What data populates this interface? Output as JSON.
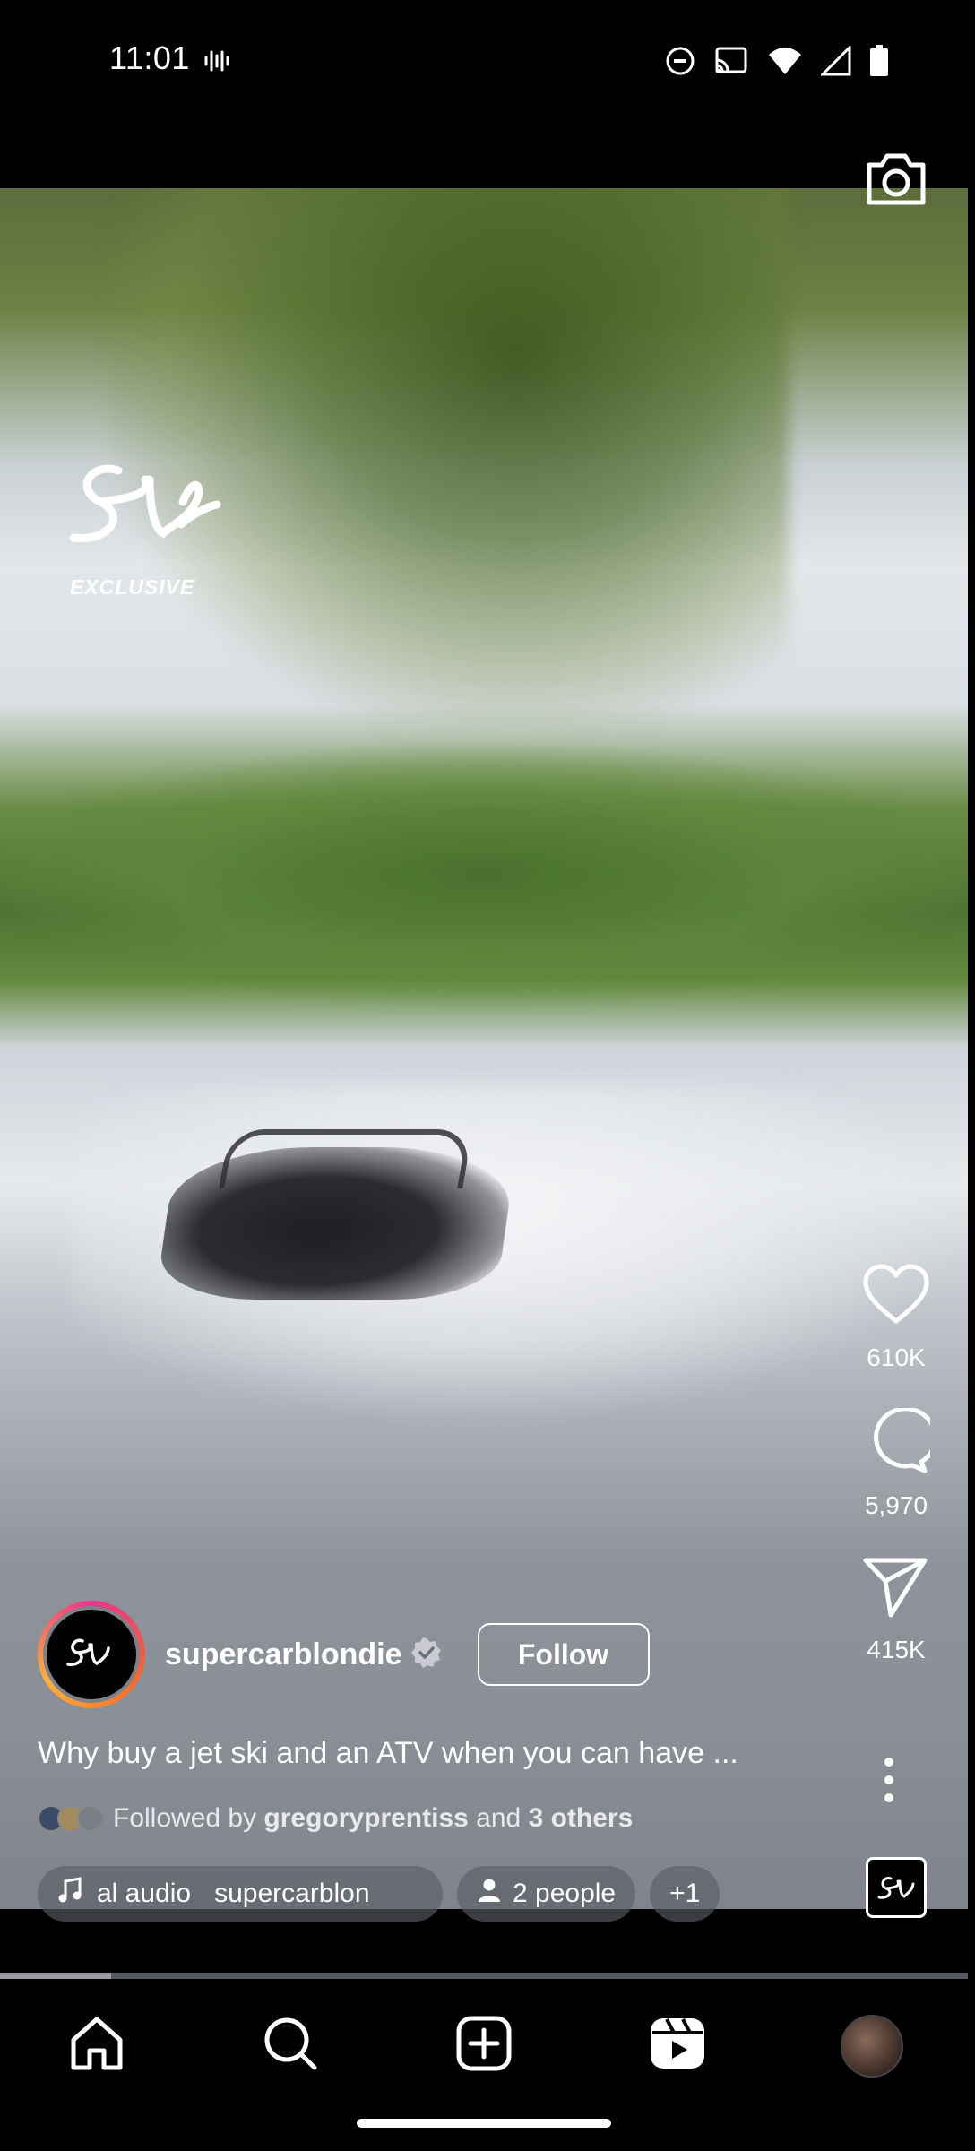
{
  "status_bar": {
    "time": "11:01",
    "icons": [
      "vibrate-icon",
      "do-not-disturb-icon",
      "cast-icon",
      "wifi-icon",
      "signal-icon",
      "battery-icon"
    ]
  },
  "video": {
    "overlay_logo": "sb",
    "overlay_label": "EXCLUSIVE",
    "camera_icon": "camera-icon"
  },
  "actions": {
    "likes": "610K",
    "comments": "5,970",
    "shares": "415K"
  },
  "author": {
    "username": "supercarblondie",
    "verified": true,
    "follow_label": "Follow"
  },
  "caption": "Why buy a jet ski and an ATV when you can have ...",
  "followed_by": {
    "prefix": "Followed by",
    "user": "gregoryprentiss",
    "middle": "and",
    "others": "3 others"
  },
  "chips": {
    "audio": "al audio",
    "audio_user": "supercarblon",
    "people": "2 people",
    "more": "+1"
  },
  "playback": {
    "progress": 0.115
  },
  "nav": {
    "items": [
      "home-icon",
      "search-icon",
      "create-icon",
      "reels-icon",
      "profile-avatar"
    ]
  },
  "colors": {
    "background": "#000000",
    "chip_bg": "#5a5e66",
    "ring_start": "#e7348e",
    "ring_end": "#fbb03b"
  }
}
